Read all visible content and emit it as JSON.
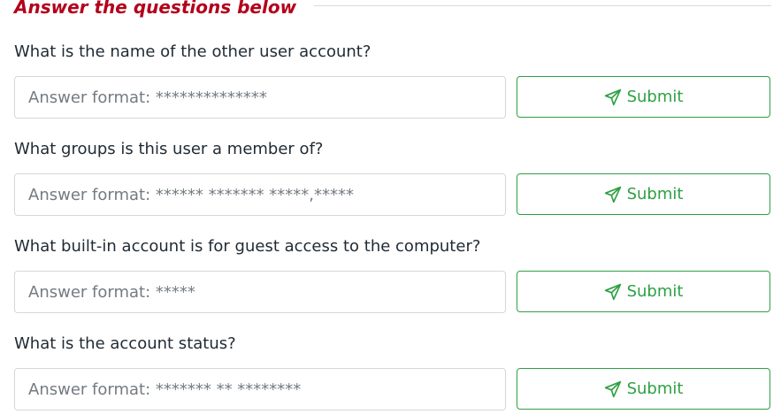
{
  "header": {
    "title": "Answer the questions below"
  },
  "questions": [
    {
      "text": "What is the name of the other user account?",
      "placeholder": "Answer format: **************",
      "submit_label": "Submit"
    },
    {
      "text": "What groups is this user a member of?",
      "placeholder": "Answer format: ****** ******* *****,*****",
      "submit_label": "Submit"
    },
    {
      "text": "What built-in account is for guest access to the computer?",
      "placeholder": "Answer format: *****",
      "submit_label": "Submit"
    },
    {
      "text": "What is the account status?",
      "placeholder": "Answer format: ******* ** ********",
      "submit_label": "Submit"
    }
  ],
  "colors": {
    "heading": "#b3001b",
    "submit_accent": "#2ea043",
    "input_border": "#d3d7db",
    "placeholder": "#737b82"
  },
  "icons": {
    "submit": "paper-plane-icon"
  }
}
